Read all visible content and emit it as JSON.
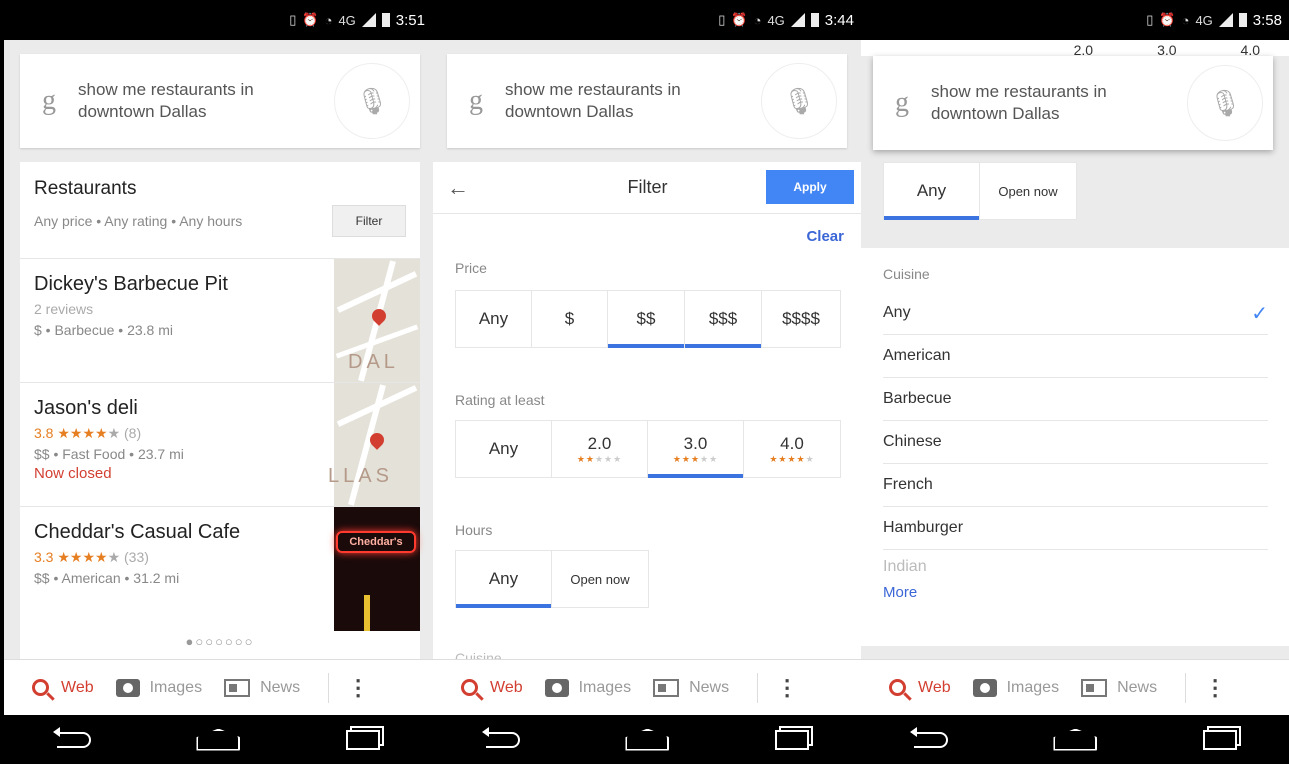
{
  "status": [
    {
      "time": "3:51",
      "net": "4G"
    },
    {
      "time": "3:44",
      "net": "4G"
    },
    {
      "time": "3:58",
      "net": "4G"
    }
  ],
  "search": {
    "g": "g",
    "query_line1": "show me restaurants in",
    "query_line2": "downtown Dallas"
  },
  "bottom_nav": {
    "web": "Web",
    "images": "Images",
    "news": "News",
    "more": "⋮"
  },
  "results": {
    "title": "Restaurants",
    "summary": "Any price • Any rating • Any hours",
    "filter_button": "Filter",
    "items": [
      {
        "name": "Dickey's Barbecue Pit",
        "reviews": "2 reviews",
        "meta": "$ • Barbecue • 23.8 mi",
        "map_label": "DAL"
      },
      {
        "name": "Jason's deli",
        "rating": "3.8 ★★★★",
        "rating_off": "★",
        "count": "(8)",
        "meta": "$$ • Fast Food • 23.7 mi",
        "status": "Now closed",
        "map_label": "LLAS"
      },
      {
        "name": "Cheddar's Casual Cafe",
        "rating": "3.3 ★★★★",
        "rating_off": "★",
        "count": "(33)",
        "meta": "$$ • American • 31.2 mi",
        "photo_label": "Cheddar's"
      }
    ],
    "pager": "●○○○○○○"
  },
  "filter": {
    "back": "←",
    "title": "Filter",
    "apply": "Apply",
    "clear": "Clear",
    "price_label": "Price",
    "price_options": [
      "Any",
      "$",
      "$$",
      "$$$",
      "$$$$"
    ],
    "rating_label": "Rating at least",
    "rating_options": [
      {
        "label": "Any"
      },
      {
        "label": "2.0",
        "on": "★★",
        "off": "★★★"
      },
      {
        "label": "3.0",
        "on": "★★★",
        "off": "★★"
      },
      {
        "label": "4.0",
        "on": "★★★★",
        "off": "★"
      }
    ],
    "hours_label": "Hours",
    "hours_options": [
      "Any",
      "Open now"
    ],
    "cuisine_fade": "Cuisine"
  },
  "panel3": {
    "top_fragments": [
      "2.0",
      "3.0",
      "4.0"
    ],
    "hours_options": [
      "Any",
      "Open now"
    ],
    "cuisine_label": "Cuisine",
    "cuisines": [
      "Any",
      "American",
      "Barbecue",
      "Chinese",
      "French",
      "Hamburger"
    ],
    "cuisine_faded": "Indian",
    "check": "✓",
    "more": "More"
  },
  "accent_colors": {
    "red": "#d23f31",
    "blue": "#4285f4",
    "orange": "#e67e22"
  }
}
